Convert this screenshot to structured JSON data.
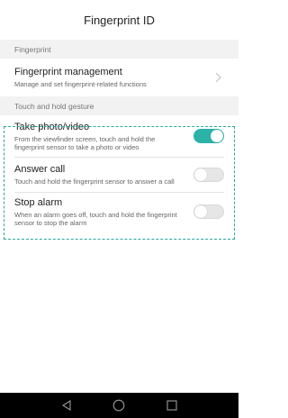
{
  "header": {
    "title": "Fingerprint ID"
  },
  "sections": {
    "fingerprint": {
      "header": "Fingerprint",
      "management": {
        "title": "Fingerprint management",
        "description": "Manage and set fingerprint-related functions"
      }
    },
    "gesture": {
      "header": "Touch and hold gesture",
      "items": [
        {
          "title": "Take photo/video",
          "description": "From the viewfinder screen, touch and hold the fingerprint sensor to take a photo or video",
          "enabled": true
        },
        {
          "title": "Answer call",
          "description": "Touch and hold the fingerprint sensor to answer a call",
          "enabled": false
        },
        {
          "title": "Stop alarm",
          "description": "When an alarm goes off, touch and hold the fingerprint sensor to stop the alarm",
          "enabled": false
        }
      ]
    }
  },
  "navbar": {
    "icons": [
      "back-icon",
      "home-icon",
      "recents-icon"
    ]
  },
  "colors": {
    "accent": "#2bb3a9",
    "highlight_border": "#2aa7a0",
    "section_bg": "#f2f2f2",
    "navbar_bg": "#000000"
  }
}
